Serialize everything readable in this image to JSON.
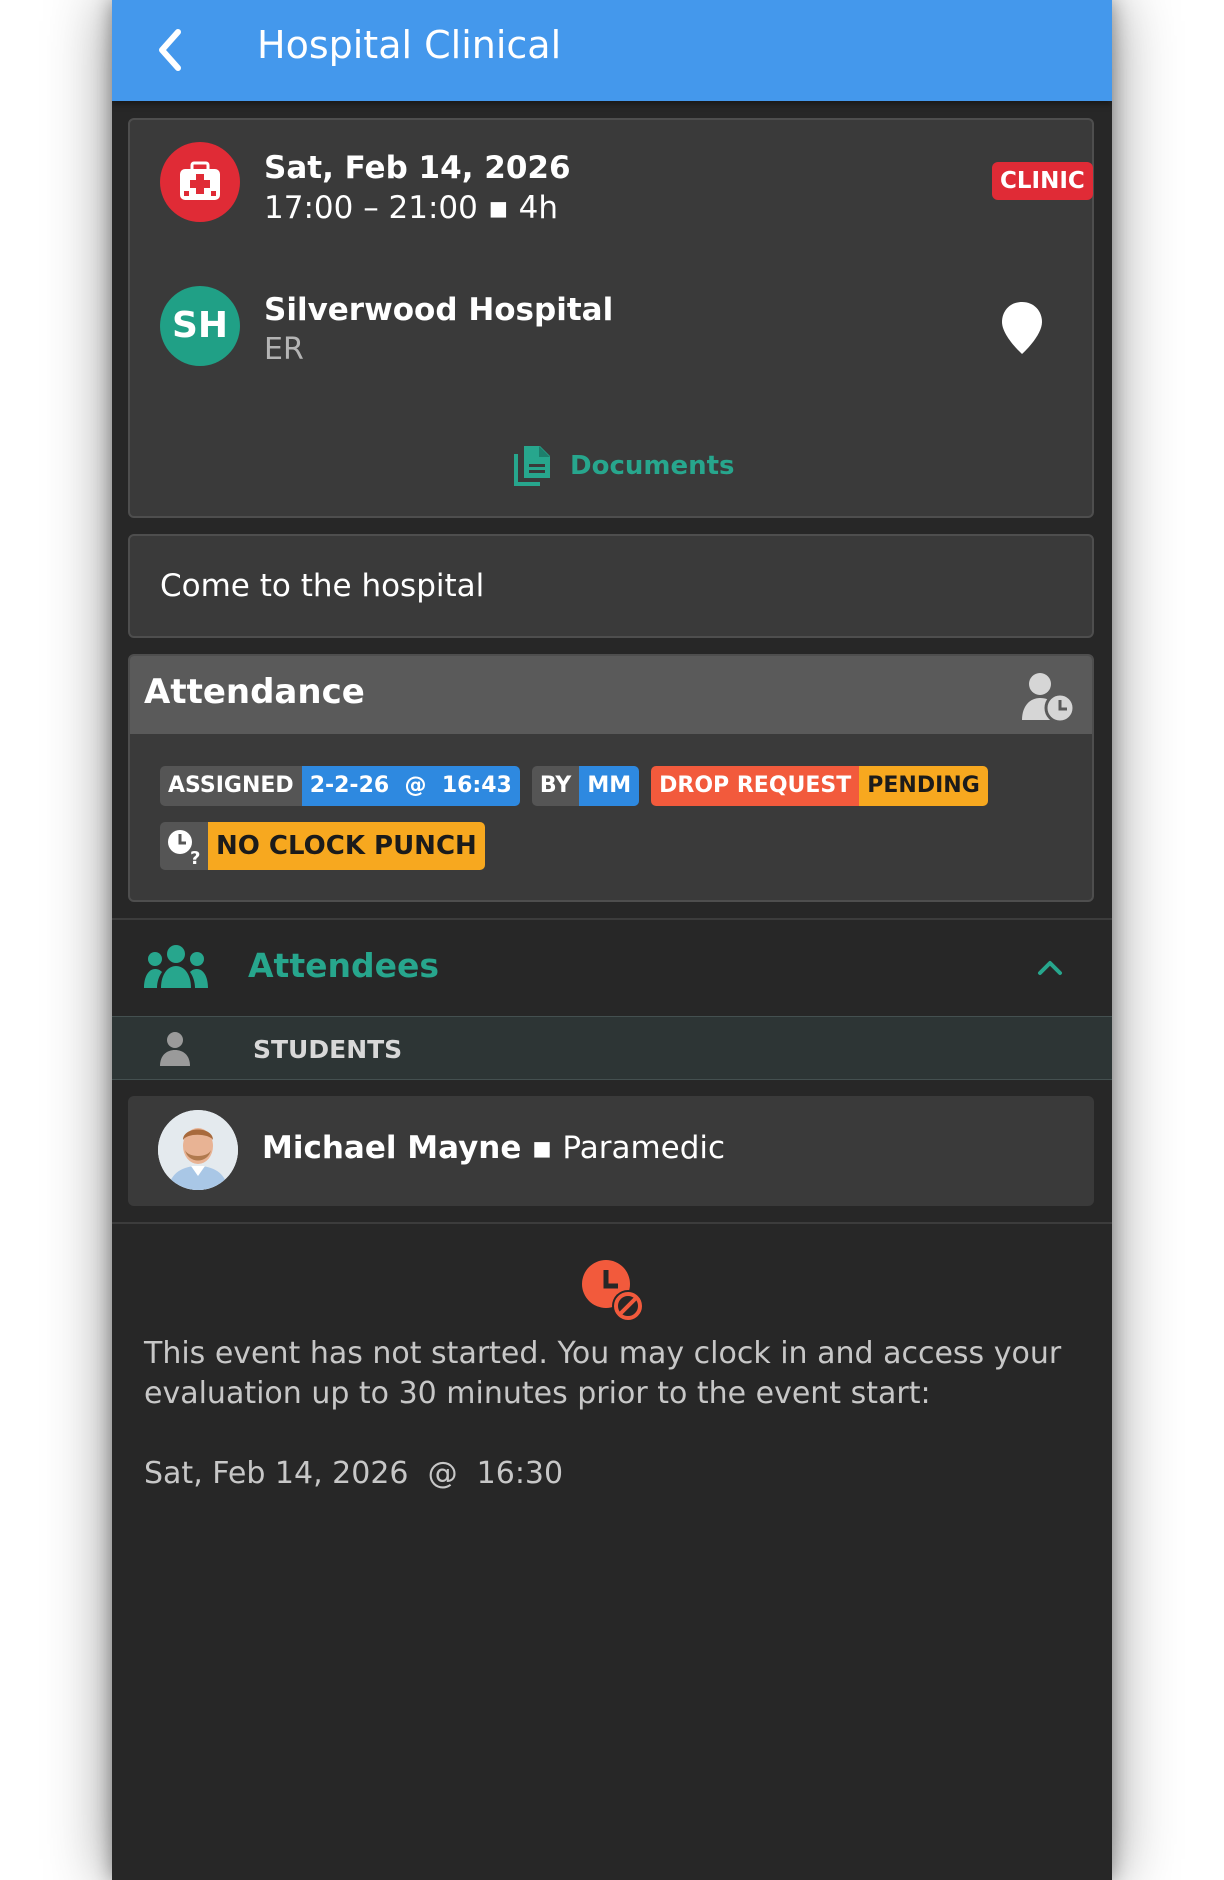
{
  "header": {
    "title": "Hospital Clinical",
    "back_icon": "chevron-left-icon"
  },
  "event": {
    "date": "Sat, Feb 14, 2026",
    "time": "17:00 – 21:00 ▪ 4h",
    "type_badge": "CLINIC",
    "type_icon": "hospital-icon",
    "site_initials": "SH",
    "site_name": "Silverwood Hospital",
    "department": "ER",
    "documents_label": "Documents"
  },
  "note": "Come to the hospital",
  "attendance": {
    "title": "Attendance",
    "tags": {
      "assigned_label": "ASSIGNED",
      "assigned_value": "2-2-26  @  16:43",
      "by_label": "BY",
      "by_value": "MM",
      "drop_label": "DROP REQUEST",
      "drop_status": "PENDING",
      "clock_label": "NO CLOCK PUNCH"
    }
  },
  "attendees": {
    "label": "Attendees",
    "group_label": "STUDENTS",
    "students": [
      {
        "name": "Michael Mayne",
        "separator": "▪",
        "role": "Paramedic"
      }
    ]
  },
  "status_message": {
    "text": "This event has not started. You may clock in and access your evaluation up to 30 minutes prior to the event start:",
    "start_time": "Sat, Feb 14, 2026  @  16:30"
  },
  "colors": {
    "appbar": "#4498ec",
    "accent_teal": "#27a68d",
    "clinic_red": "#e02b36",
    "orange": "#f7a81f",
    "drop_red": "#f25a3c",
    "blue": "#2e89e0",
    "background": "#272727",
    "card": "#3a3a3a"
  }
}
